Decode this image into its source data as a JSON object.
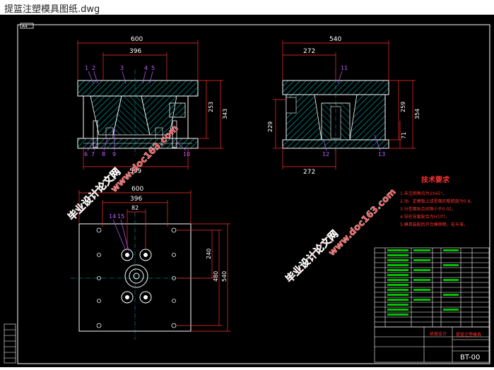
{
  "window": {
    "title": "提篮注塑模具图纸.dwg"
  },
  "sheet": {
    "corner_tag": "A4"
  },
  "front_view": {
    "dims": {
      "width": "600",
      "inner": "396",
      "height_upper": "253",
      "height_total": "343",
      "bottom": "599"
    },
    "parts": [
      "1",
      "2",
      "3",
      "4",
      "5",
      "6",
      "7",
      "8",
      "9",
      "10"
    ]
  },
  "side_view": {
    "dims": {
      "width": "540",
      "left": "272",
      "bottom": "272",
      "h1": "259",
      "h2": "354",
      "h3": "229",
      "h4": "71"
    },
    "parts": [
      "11",
      "12",
      "13"
    ]
  },
  "plan_view": {
    "dims": {
      "width": "600",
      "inner": "396",
      "pitch": "82",
      "v1": "240",
      "v2": "480",
      "v3": "540"
    },
    "parts": [
      "14",
      "15"
    ]
  },
  "tech_req": {
    "heading": "技术要求",
    "items": [
      "1.未注倒角均为2X45°。",
      "2.动、定模板上成型面的粗糙度为0.8。",
      "3.分型面贴合间隙小于0.02。",
      "4.导柱导套配合为H7/f7。",
      "5.模具装配后开合模顺畅，无卡滞。"
    ]
  },
  "title_block": {
    "drawing_no": "BT-00",
    "project": "提篮注塑模具",
    "company": "机械设计"
  },
  "watermarks": [
    "毕业设计论文网",
    "www.doc163.com"
  ],
  "colors": {
    "background": "#000000",
    "line": "#ffffff",
    "hatch": "#00c0c0",
    "dim": "#ff3030",
    "leader": "#c060ff",
    "watermark": "#ff4040",
    "text": "#ffff00"
  }
}
